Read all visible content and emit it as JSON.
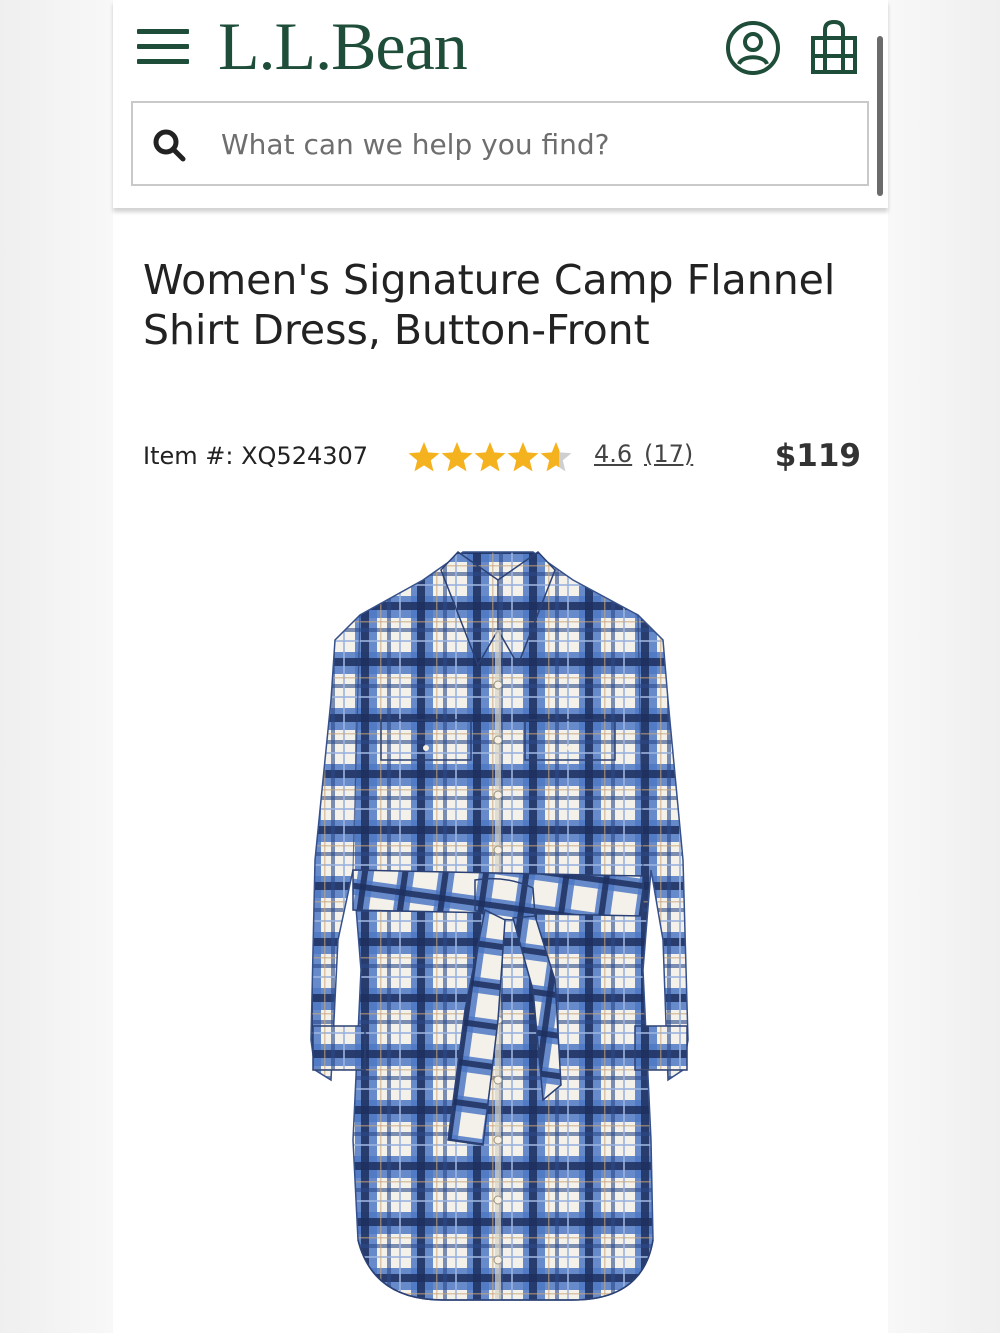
{
  "header": {
    "logo_text": "L.L.Bean",
    "brand_color": "#1e4d39",
    "menu_icon": "hamburger-menu-icon",
    "account_icon": "account-icon",
    "bag_icon": "shopping-bag-icon"
  },
  "search": {
    "placeholder": "What can we help you find?",
    "icon": "search-icon"
  },
  "product": {
    "title": "Women's Signature Camp Flannel Shirt Dress, Button-Front",
    "item_number": "Item #: XQ524307",
    "rating_value": "4.6",
    "rating_stars": 4.6,
    "review_count": "(17)",
    "price": "$119",
    "star_color": "#f5b21f",
    "image_description_icon": "plaid-shirt-dress-image"
  }
}
